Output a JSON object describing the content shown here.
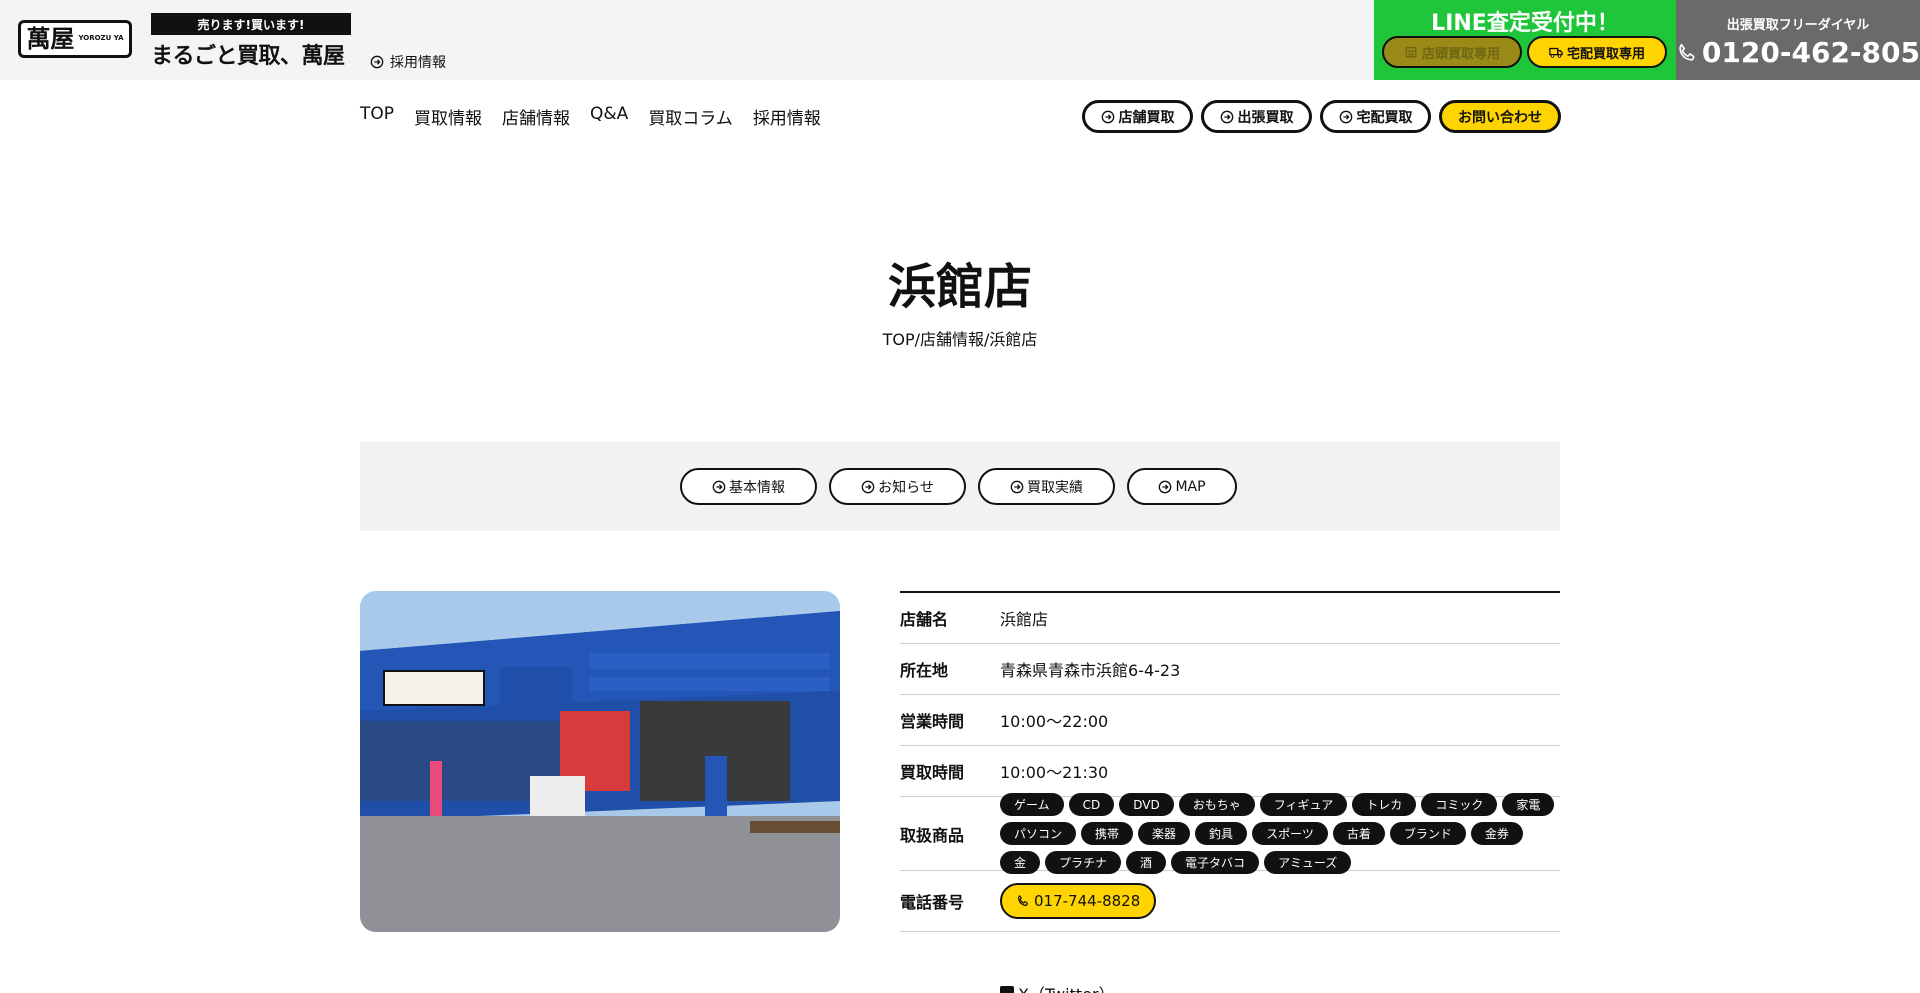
{
  "header": {
    "logo_main": "萬屋",
    "logo_sub": "YOROZU YA",
    "tagline": "売ります!買います!",
    "brand": "まるごと買取、萬屋",
    "recruit_link": "採用情報",
    "line": {
      "title": "LINE査定受付中！",
      "store_button": "店頭買取専用",
      "home_button": "宅配買取専用"
    },
    "phone": {
      "label": "出張買取フリーダイヤル",
      "number": "0120-462-805"
    }
  },
  "nav": {
    "items": [
      "TOP",
      "買取情報",
      "店舗情報",
      "Q&A",
      "買取コラム",
      "採用情報"
    ],
    "buttons": [
      "店舗買取",
      "出張買取",
      "宅配買取"
    ],
    "contact": "お問い合わせ"
  },
  "page": {
    "title": "浜館店",
    "breadcrumb": "TOP/店舗情報/浜館店"
  },
  "anchors": [
    "基本情報",
    "お知らせ",
    "買取実績",
    "MAP"
  ],
  "info": {
    "rows": [
      {
        "label": "店舗名",
        "value": "浜館店"
      },
      {
        "label": "所在地",
        "value": "青森県青森市浜館6-4-23"
      },
      {
        "label": "営業時間",
        "value": "10:00〜22:00"
      },
      {
        "label": "買取時間",
        "value": "10:00〜21:30"
      }
    ],
    "items_label": "取扱商品",
    "items": [
      "ゲーム",
      "CD",
      "DVD",
      "おもちゃ",
      "フィギュア",
      "トレカ",
      "コミック",
      "家電",
      "パソコン",
      "携帯",
      "楽器",
      "釣具",
      "スポーツ",
      "古着",
      "ブランド",
      "金券",
      "金",
      "プラチナ",
      "酒",
      "電子タバコ",
      "アミューズ"
    ],
    "phone_label": "電話番号",
    "phone": "017-744-8828",
    "twitter": "X（Twitter）"
  },
  "colors": {
    "line_green": "#20c63a",
    "accent_yellow": "#ffd400",
    "phone_gray": "#6a6a6a",
    "header_bg": "#f4f4f4"
  }
}
